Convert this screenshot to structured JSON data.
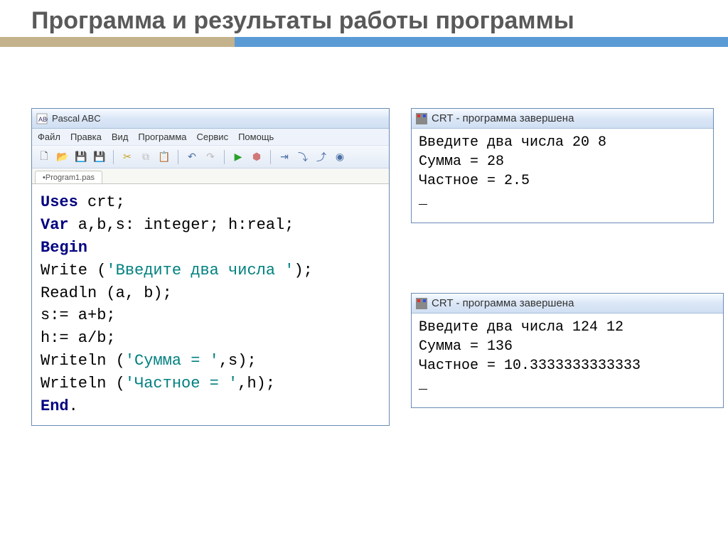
{
  "title": "Программа и результаты работы программы",
  "pascal_window": {
    "app_title": "Pascal ABC",
    "menu": [
      "Файл",
      "Правка",
      "Вид",
      "Программа",
      "Сервис",
      "Помощь"
    ],
    "tab": "•Program1.pas",
    "code": {
      "l1a": "Uses",
      "l1b": " crt;",
      "l2a": "Var",
      "l2b": " a,b,s: integer; h:real;",
      "l3": "Begin",
      "l4a": "Write (",
      "l4s": "'Введите два числа '",
      "l4b": ");",
      "l5": "Readln (a, b);",
      "l6": "s:= a+b;",
      "l7": "h:= a/b;",
      "l8a": "Writeln (",
      "l8s": "'Сумма = '",
      "l8b": ",s);",
      "l9a": "Writeln (",
      "l9s": "'Частное = '",
      "l9b": ",h);",
      "l10a": "End",
      "l10b": "."
    }
  },
  "crt1": {
    "title": "CRT - программа завершена",
    "body": "Введите два числа 20 8\nСумма = 28\nЧастное = 2.5\n_"
  },
  "crt2": {
    "title": "CRT - программа завершена",
    "body": "Введите два числа 124 12\nСумма = 136\nЧастное = 10.3333333333333\n_"
  }
}
